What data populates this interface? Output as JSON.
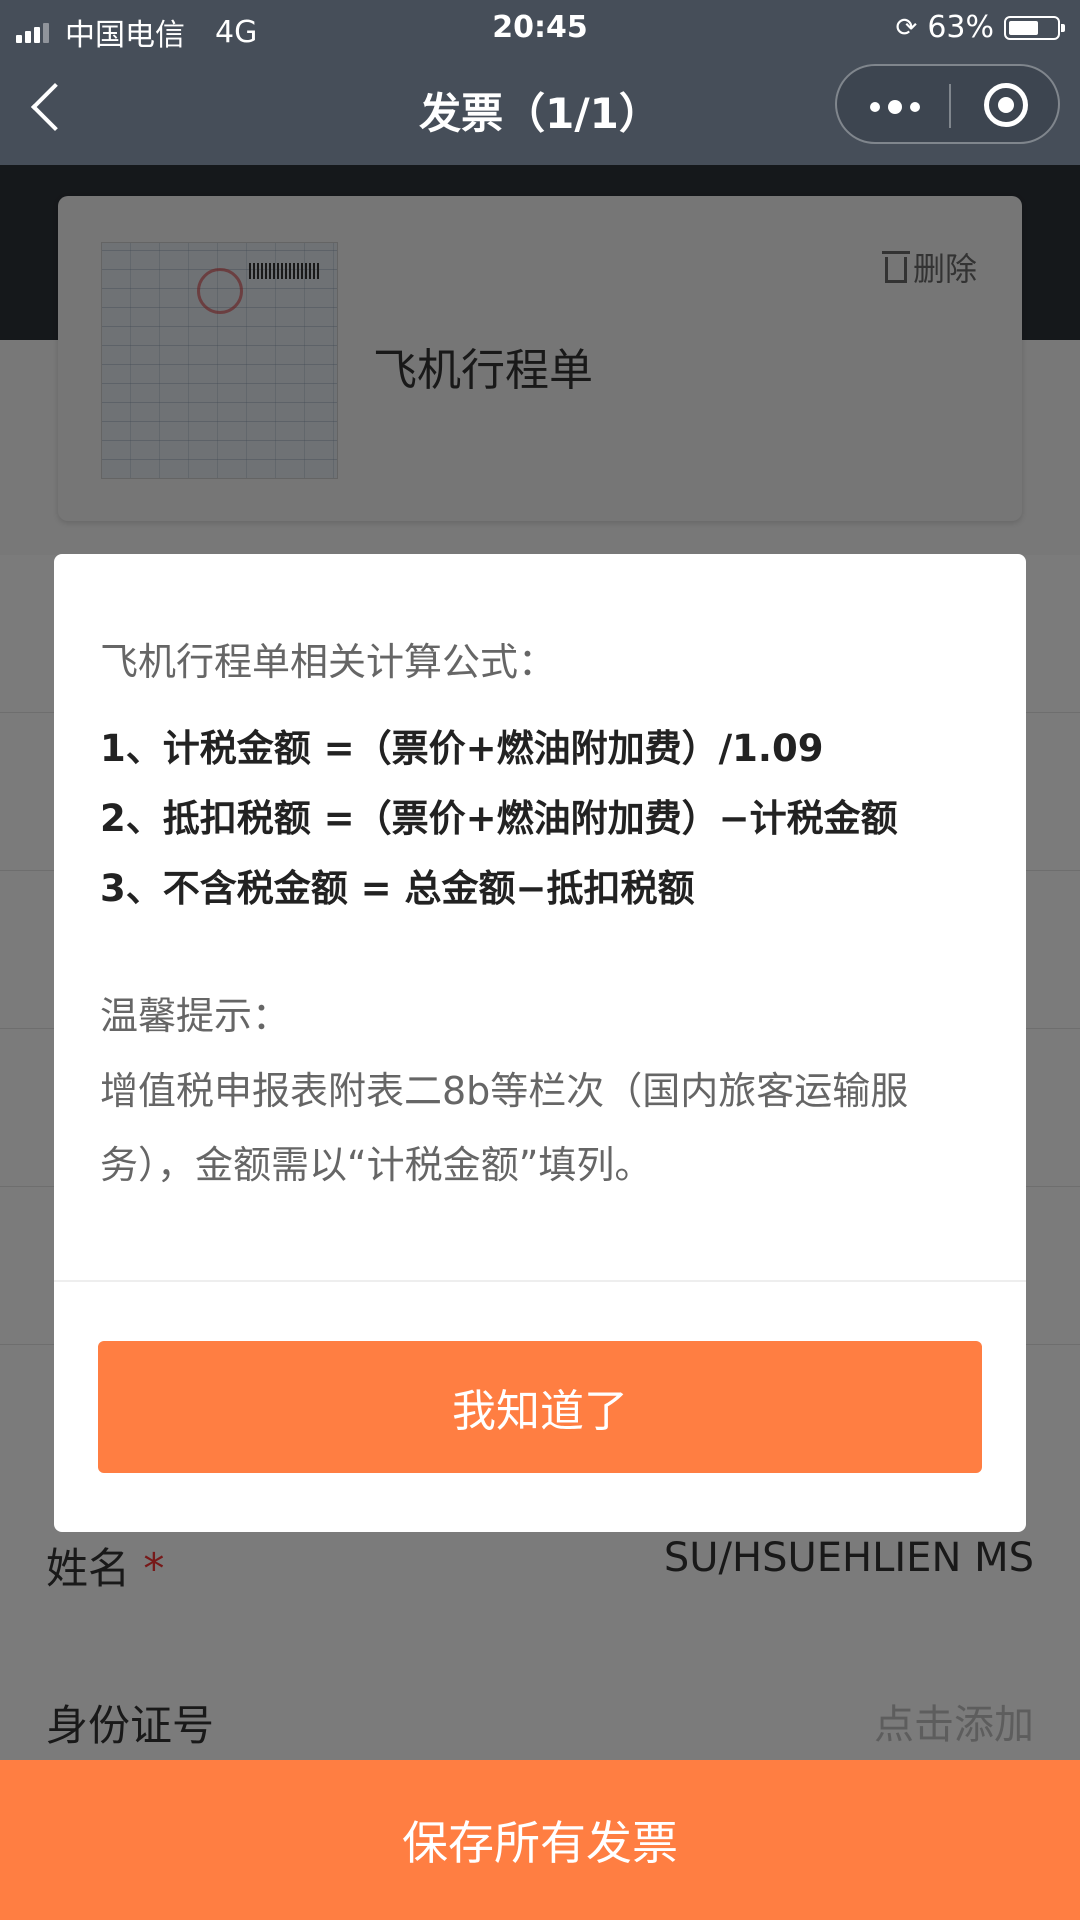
{
  "status_bar": {
    "carrier": "中国电信",
    "network": "4G",
    "time": "20:45",
    "battery": "63%",
    "battery_level": 0.63
  },
  "nav": {
    "title": "发票（1/1）",
    "icons": [
      "back-icon",
      "more-icon",
      "target-icon"
    ]
  },
  "invoice_card": {
    "title": "飞机行程单",
    "delete_label": "删除"
  },
  "form": {
    "name_label": "姓名",
    "required_mark": "*",
    "name_value": "SU/HSUEHLIEN MS",
    "id_label": "身份证号",
    "id_placeholder": "点击添加"
  },
  "modal": {
    "heading": "飞机行程单相关计算公式：",
    "formulas": [
      "1、计税金额 =（票价+燃油附加费）/1.09",
      "2、抵扣税额 =（票价+燃油附加费）−计税金额",
      "3、不含税金额 = 总金额−抵扣税额"
    ],
    "tip_heading": "温馨提示：",
    "tip_text": "增值税申报表附表二8b等栏次（国内旅客运输服务），金额需以“计税金额”填列。",
    "confirm_button": "我知道了"
  },
  "footer": {
    "save_button": "保存所有发票"
  },
  "colors": {
    "accent": "#ff7e42",
    "navbar": "#464e59"
  }
}
